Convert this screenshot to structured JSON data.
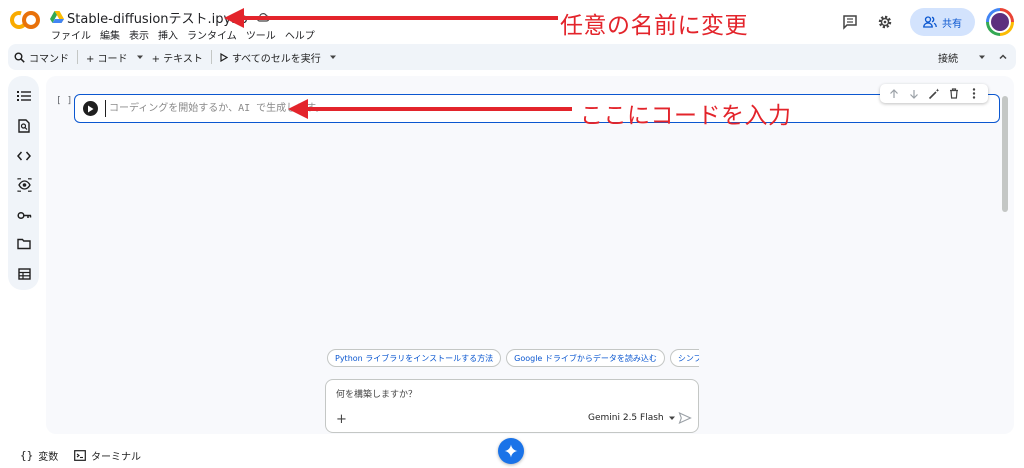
{
  "app": {
    "doc_title": "Stable-diffusionテスト.ipynb",
    "menu": [
      "ファイル",
      "編集",
      "表示",
      "挿入",
      "ランタイム",
      "ツール",
      "ヘルプ"
    ],
    "share_label": "共有"
  },
  "toolbar": {
    "command": "コマンド",
    "add_code": "+ コード",
    "add_text": "+ テキスト",
    "run_all": "すべてのセルを実行",
    "connect": "接続"
  },
  "sidebar": {
    "items": [
      "toc-icon",
      "search-icon",
      "code-snippets-icon",
      "variables-icon",
      "secrets-key-icon",
      "folder-icon",
      "table-icon"
    ]
  },
  "cell": {
    "bracket": "[ ]",
    "placeholder": "コーディングを開始するか、AI で生成します。"
  },
  "suggestions": [
    "Python ライブラリをインストールする方法",
    "Google ドライブからデータを読み込む",
    "シンプルな M"
  ],
  "prompt": {
    "placeholder": "何を構築しますか？",
    "model": "Gemini 2.5 Flash"
  },
  "bottom": {
    "variables": "変数",
    "terminal": "ターミナル"
  },
  "annotations": {
    "rename": "任意の名前に変更",
    "code_here": "ここにコードを入力"
  },
  "colors": {
    "accent": "#0b57d0",
    "annotation": "#e3242b",
    "logo_orange": "#f9ab00",
    "logo_dark_orange": "#e8710a"
  }
}
